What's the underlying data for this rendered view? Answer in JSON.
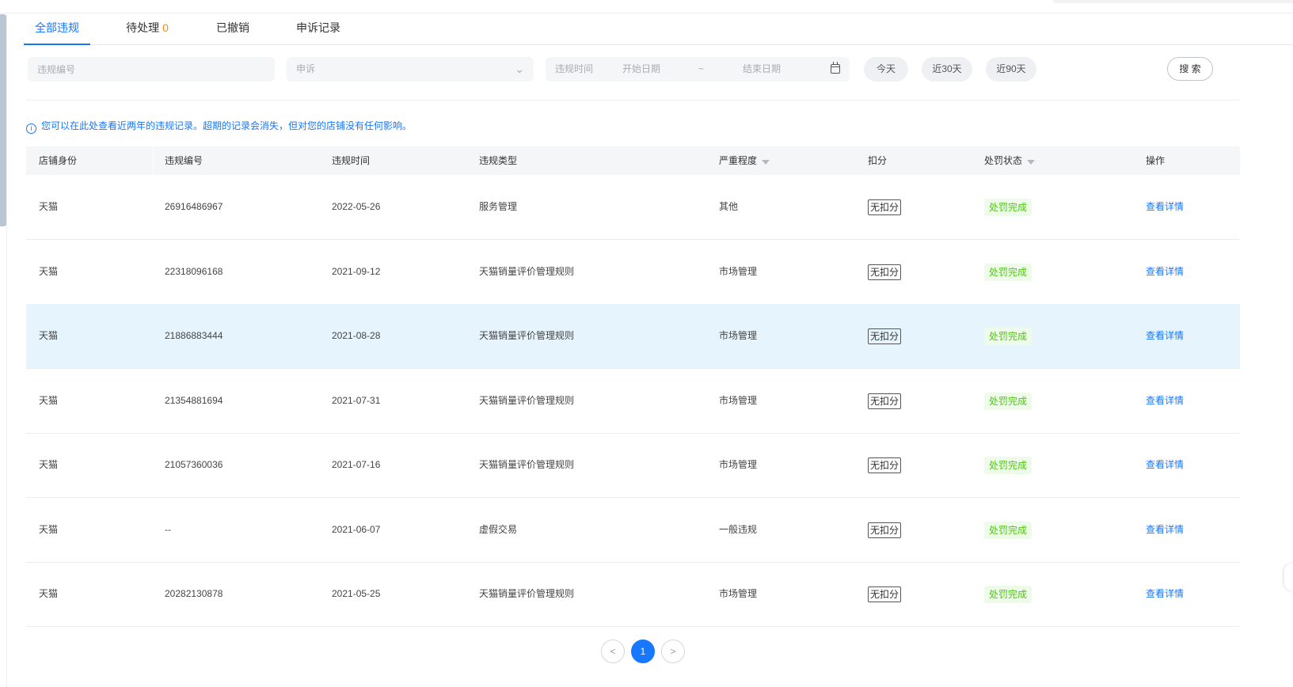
{
  "tabs": [
    {
      "label": "全部违规",
      "active": true
    },
    {
      "label": "待处理",
      "count": "0"
    },
    {
      "label": "已撤销"
    },
    {
      "label": "申诉记录"
    }
  ],
  "filters": {
    "violation_no_placeholder": "违规编号",
    "appeal_select": "申诉",
    "time_label": "违规时间",
    "start_placeholder": "开始日期",
    "range_sep": "~",
    "end_placeholder": "结束日期",
    "quick": [
      "今天",
      "近30天",
      "近90天"
    ],
    "search_label": "搜 索"
  },
  "notice": "您可以在此处查看近两年的违规记录。超期的记录会消失，但对您的店铺没有任何影响。",
  "table": {
    "columns": [
      "店铺身份",
      "违规编号",
      "违规时间",
      "违规类型",
      "严重程度",
      "扣分",
      "处罚状态",
      "操作"
    ],
    "rows": [
      {
        "shop": "天猫",
        "no": "26916486967",
        "time": "2022-05-26",
        "type": "服务管理",
        "severity": "其他",
        "points": "无扣分",
        "status": "处罚完成",
        "action": "查看详情"
      },
      {
        "shop": "天猫",
        "no": "22318096168",
        "time": "2021-09-12",
        "type": "天猫销量评价管理规则",
        "severity": "市场管理",
        "points": "无扣分",
        "status": "处罚完成",
        "action": "查看详情"
      },
      {
        "shop": "天猫",
        "no": "21886883444",
        "time": "2021-08-28",
        "type": "天猫销量评价管理规则",
        "severity": "市场管理",
        "points": "无扣分",
        "status": "处罚完成",
        "action": "查看详情",
        "highlighted": true
      },
      {
        "shop": "天猫",
        "no": "21354881694",
        "time": "2021-07-31",
        "type": "天猫销量评价管理规则",
        "severity": "市场管理",
        "points": "无扣分",
        "status": "处罚完成",
        "action": "查看详情"
      },
      {
        "shop": "天猫",
        "no": "21057360036",
        "time": "2021-07-16",
        "type": "天猫销量评价管理规则",
        "severity": "市场管理",
        "points": "无扣分",
        "status": "处罚完成",
        "action": "查看详情"
      },
      {
        "shop": "天猫",
        "no": "--",
        "time": "2021-06-07",
        "type": "虚假交易",
        "severity": "一般违规",
        "points": "无扣分",
        "status": "处罚完成",
        "action": "查看详情"
      },
      {
        "shop": "天猫",
        "no": "20282130878",
        "time": "2021-05-25",
        "type": "天猫销量评价管理规则",
        "severity": "市场管理",
        "points": "无扣分",
        "status": "处罚完成",
        "action": "查看详情"
      }
    ]
  },
  "pagination": {
    "prev": "<",
    "current": "1",
    "next": ">"
  },
  "icons": {
    "info": "info-circle-icon",
    "calendar": "calendar-icon",
    "chevron": "chevron-down-icon",
    "filter": "filter-icon"
  },
  "colors": {
    "accent": "#1677ff",
    "pending_count": "#ff8a00",
    "success": "#52c41a",
    "highlight_row": "#e6f5fd"
  }
}
